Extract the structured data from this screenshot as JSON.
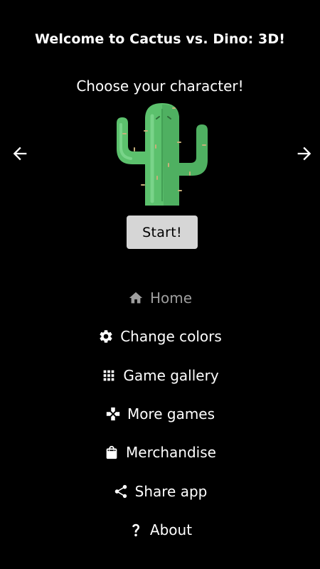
{
  "header": {
    "title": "Welcome to Cactus vs. Dino: 3D!",
    "subtitle": "Choose your character!"
  },
  "character": {
    "selected": "cactus"
  },
  "start_button": {
    "label": "Start!"
  },
  "menu": {
    "items": [
      {
        "label": "Home",
        "icon": "home-icon",
        "active": true
      },
      {
        "label": "Change colors",
        "icon": "gear-icon"
      },
      {
        "label": "Game gallery",
        "icon": "grid-icon"
      },
      {
        "label": "More games",
        "icon": "gamepad-icon"
      },
      {
        "label": "Merchandise",
        "icon": "shopping-bag-icon"
      },
      {
        "label": "Share app",
        "icon": "share-icon"
      },
      {
        "label": "About",
        "icon": "question-icon"
      }
    ]
  },
  "colors": {
    "background": "#000000",
    "text": "#ffffff",
    "active_menu": "#9e9e9e",
    "button_bg": "#d6d6d6",
    "cactus_green": "#5cc16d"
  }
}
